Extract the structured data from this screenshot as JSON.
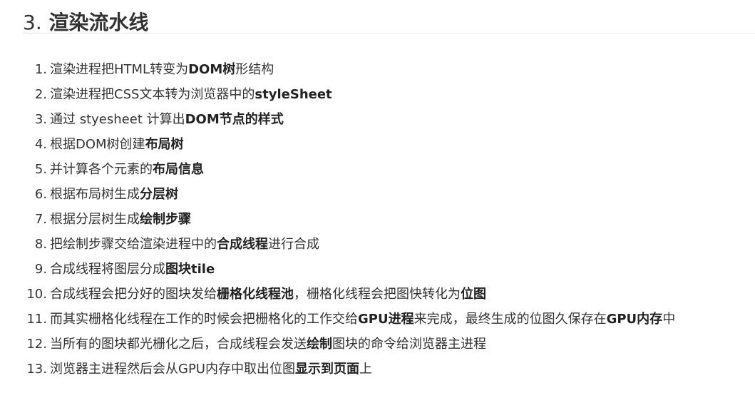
{
  "section": {
    "number": "3.",
    "title": "渲染流水线"
  },
  "steps": [
    {
      "index": "1.",
      "segments": [
        {
          "text": "渲染进程把HTML转变为",
          "bold": false
        },
        {
          "text": "DOM树",
          "bold": true
        },
        {
          "text": "形结构",
          "bold": false
        }
      ]
    },
    {
      "index": "2.",
      "segments": [
        {
          "text": "渲染进程把CSS文本转为浏览器中的",
          "bold": false
        },
        {
          "text": "styleSheet",
          "bold": true
        }
      ]
    },
    {
      "index": "3.",
      "segments": [
        {
          "text": "通过 styesheet 计算出",
          "bold": false
        },
        {
          "text": "DOM节点的样式",
          "bold": true
        }
      ]
    },
    {
      "index": "4.",
      "segments": [
        {
          "text": "根据DOM树创建",
          "bold": false
        },
        {
          "text": "布局树",
          "bold": true
        }
      ]
    },
    {
      "index": "5.",
      "segments": [
        {
          "text": "并计算各个元素的",
          "bold": false
        },
        {
          "text": "布局信息",
          "bold": true
        }
      ]
    },
    {
      "index": "6.",
      "segments": [
        {
          "text": "根据布局树生成",
          "bold": false
        },
        {
          "text": "分层树",
          "bold": true
        }
      ]
    },
    {
      "index": "7.",
      "segments": [
        {
          "text": "根据分层树生成",
          "bold": false
        },
        {
          "text": "绘制步骤",
          "bold": true
        }
      ]
    },
    {
      "index": "8.",
      "segments": [
        {
          "text": "把绘制步骤交给渲染进程中的",
          "bold": false
        },
        {
          "text": "合成线程",
          "bold": true
        },
        {
          "text": "进行合成",
          "bold": false
        }
      ]
    },
    {
      "index": "9.",
      "segments": [
        {
          "text": "合成线程将图层分成",
          "bold": false
        },
        {
          "text": "图块tile",
          "bold": true
        }
      ]
    },
    {
      "index": "10.",
      "segments": [
        {
          "text": "合成线程会把分好的图块发给",
          "bold": false
        },
        {
          "text": "栅格化线程池",
          "bold": true
        },
        {
          "text": "，栅格化线程会把图快转化为",
          "bold": false
        },
        {
          "text": "位图",
          "bold": true
        }
      ]
    },
    {
      "index": "11.",
      "segments": [
        {
          "text": "而其实栅格化线程在工作的时候会把栅格化的工作交给",
          "bold": false
        },
        {
          "text": "GPU进程",
          "bold": true
        },
        {
          "text": "来完成，最终生成的位图久保存在",
          "bold": false
        },
        {
          "text": "GPU内存",
          "bold": true
        },
        {
          "text": "中",
          "bold": false
        }
      ]
    },
    {
      "index": "12.",
      "segments": [
        {
          "text": "当所有的图块都光栅化之后，合成线程会发送",
          "bold": false
        },
        {
          "text": "绘制",
          "bold": true
        },
        {
          "text": "图块的命令给浏览器主进程",
          "bold": false
        }
      ]
    },
    {
      "index": "13.",
      "segments": [
        {
          "text": "浏览器主进程然后会从GPU内存中取出位图",
          "bold": false
        },
        {
          "text": "显示到页面",
          "bold": true
        },
        {
          "text": "上",
          "bold": false
        }
      ]
    }
  ]
}
